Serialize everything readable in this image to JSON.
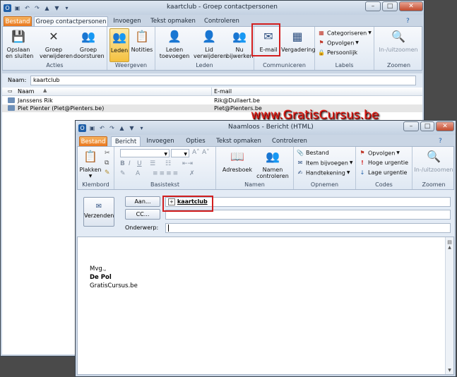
{
  "window1": {
    "title": "kaartclub - Groep contactpersonen",
    "tabs": [
      "Bestand",
      "Groep contactpersonen",
      "Invoegen",
      "Tekst opmaken",
      "Controleren"
    ],
    "ribbon": {
      "acties": {
        "label": "Acties",
        "save": "Opslaan\nen sluiten",
        "delete": "Groep\nverwijderen",
        "forward": "Groep\ndoorsturen"
      },
      "weergeven": {
        "label": "Weergeven",
        "members": "Leden",
        "notes": "Notities"
      },
      "leden": {
        "label": "Leden",
        "add": "Leden\ntoevoegen",
        "remove": "Lid\nverwijderen",
        "update": "Nu\nbijwerken"
      },
      "communiceren": {
        "label": "Communiceren",
        "email": "E-mail",
        "meeting": "Vergadering"
      },
      "labels": {
        "label": "Labels",
        "categorize": "Categoriseren",
        "followup": "Opvolgen",
        "private": "Persoonlijk"
      },
      "zoomen": {
        "label": "Zoomen",
        "zoom": "In-/uitzoomen"
      }
    },
    "name_label": "Naam:",
    "name_value": "kaartclub",
    "columns": [
      "Naam",
      "E-mail"
    ],
    "rows": [
      {
        "name": "Janssens Rik",
        "email": "Rik@Dullaert.be"
      },
      {
        "name": "Piet Pienter (Piet@Pienters.be)",
        "email": "Piet@Pienters.be"
      }
    ]
  },
  "watermark": "www.GratisCursus.be",
  "window2": {
    "title": "Naamloos - Bericht (HTML)",
    "tabs": [
      "Bestand",
      "Bericht",
      "Invoegen",
      "Opties",
      "Tekst opmaken",
      "Controleren"
    ],
    "ribbon": {
      "klembord": {
        "label": "Klembord",
        "paste": "Plakken"
      },
      "basistekst": {
        "label": "Basistekst"
      },
      "namen": {
        "label": "Namen",
        "addressbook": "Adresboek",
        "checknames": "Namen\ncontroleren"
      },
      "opnemen": {
        "label": "Opnemen",
        "file": "Bestand",
        "item": "Item bijvoegen",
        "signature": "Handtekening"
      },
      "codes": {
        "label": "Codes",
        "followup": "Opvolgen",
        "high": "Hoge urgentie",
        "low": "Lage urgentie"
      },
      "zoomen": {
        "label": "Zoomen",
        "zoom": "In-/uitzoomen"
      }
    },
    "send": "Verzenden",
    "to_btn": "Aan...",
    "cc_btn": "CC...",
    "subject_label": "Onderwerp:",
    "to_value": "kaartclub",
    "body": {
      "line1": "Mvg.,",
      "line2": "De Pol",
      "line3": "GratisCursus.be"
    }
  },
  "colors": {
    "accent_red": "#d21f1f",
    "file_tab": "#e9771f"
  }
}
